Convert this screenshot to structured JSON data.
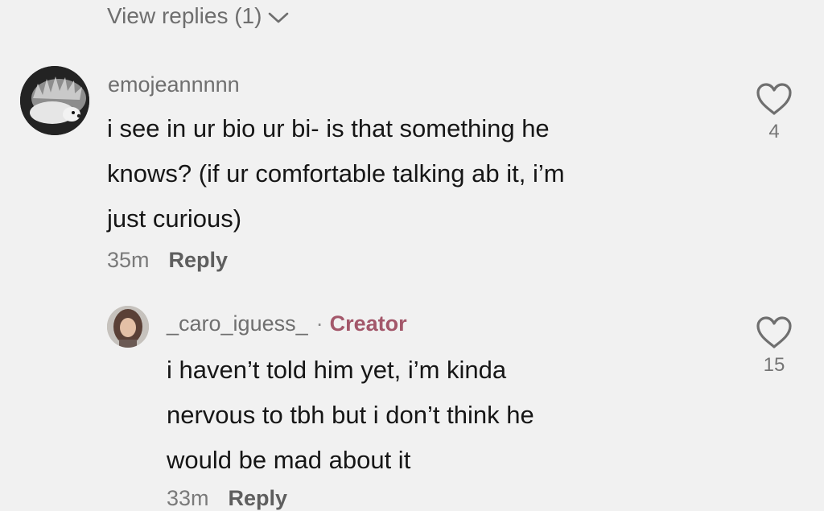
{
  "thread": {
    "view_replies_label": "View replies (1)"
  },
  "comment": {
    "username": "emojeannnnn",
    "lines": [
      "i see in ur bio ur bi- is that something he",
      "knows? (if ur comfortable talking ab it, i’m",
      "just curious)"
    ],
    "timestamp": "35m",
    "reply_label": "Reply",
    "like_count": "4"
  },
  "reply": {
    "username": "_caro_iguess_",
    "separator": "·",
    "badge": "Creator",
    "lines": [
      "i haven’t told him yet, i’m kinda",
      "nervous to tbh but i don’t think he",
      "would be mad about it"
    ],
    "timestamp": "33m",
    "reply_label": "Reply",
    "like_count": "15"
  },
  "icons": {
    "heart": "heart-icon",
    "chevron": "chevron-down-icon"
  },
  "colors": {
    "background": "#f1f1f1",
    "text": "#161616",
    "muted": "#6f6f6f",
    "creator": "#a3576a"
  }
}
